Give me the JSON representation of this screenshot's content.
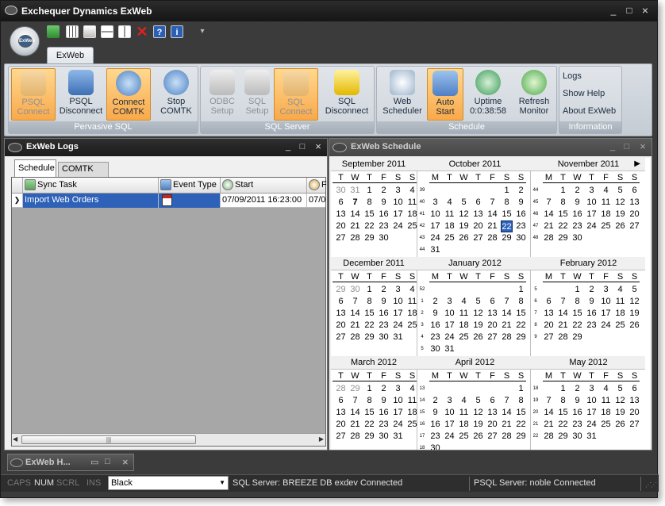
{
  "window": {
    "title": "Exchequer Dynamics ExWeb",
    "controls": [
      "_",
      "□",
      "×"
    ]
  },
  "app_orb": {
    "label": "ExWeb"
  },
  "quick_access": {
    "icons": [
      "export-icon",
      "table-icon",
      "windows-cascade-icon",
      "tile-horizontal-icon",
      "tile-vertical-icon",
      "close-red-x-icon",
      "help-icon",
      "info-icon"
    ],
    "more": "▾"
  },
  "ribbon": {
    "tab": "ExWeb",
    "groups": [
      {
        "label": "Pervasive SQL",
        "buttons": [
          {
            "line1": "PSQL",
            "line2": "Connect",
            "state": "highlighted-disabled"
          },
          {
            "line1": "PSQL",
            "line2": "Disconnect",
            "state": "normal"
          },
          {
            "line1": "Connect",
            "line2": "COMTK",
            "state": "highlighted"
          },
          {
            "line1": "Stop",
            "line2": "COMTK",
            "state": "normal"
          }
        ]
      },
      {
        "label": "SQL Server",
        "buttons": [
          {
            "line1": "ODBC",
            "line2": "Setup",
            "state": "disabled"
          },
          {
            "line1": "SQL",
            "line2": "Setup",
            "state": "disabled"
          },
          {
            "line1": "SQL",
            "line2": "Connect",
            "state": "highlighted-disabled"
          },
          {
            "line1": "SQL",
            "line2": "Disconnect",
            "state": "normal"
          }
        ]
      },
      {
        "label": "Schedule",
        "buttons": [
          {
            "line1": "Web",
            "line2": "Scheduler",
            "state": "normal"
          },
          {
            "line1": "Auto",
            "line2": "Start",
            "state": "highlighted"
          },
          {
            "line1": "Uptime",
            "line2": "0:0:38:58",
            "state": "normal"
          },
          {
            "line1": "Refresh",
            "line2": "Monitor",
            "state": "normal"
          }
        ]
      },
      {
        "label": "Information",
        "links": [
          "Logs",
          "Show Help",
          "About ExWeb"
        ]
      }
    ]
  },
  "logs_panel": {
    "title": "ExWeb Logs",
    "tabs": [
      "Schedule",
      "COMTK Log"
    ],
    "columns": [
      "Sync Task",
      "Event Type",
      "Start",
      "F"
    ],
    "rows": [
      {
        "sync_task": "Import Web Orders",
        "event_type": "",
        "start": "07/09/2011 16:23:00",
        "finish": "07/0"
      }
    ]
  },
  "schedule_panel": {
    "title": "ExWeb Schedule",
    "dow": [
      "T",
      "W",
      "T",
      "F",
      "S",
      "S"
    ],
    "dow_full": [
      "M",
      "T",
      "W",
      "T",
      "F",
      "S",
      "S"
    ],
    "months": [
      {
        "name": "September 2011",
        "leading_grey": [
          "30",
          "31"
        ]
      },
      {
        "name": "October 2011"
      },
      {
        "name": "November 2011"
      },
      {
        "name": "December 2011"
      },
      {
        "name": "January 2012"
      },
      {
        "name": "February 2012"
      },
      {
        "name": "March 2012"
      },
      {
        "name": "April 2012"
      },
      {
        "name": "May 2012"
      }
    ],
    "today": "7",
    "selected": "22",
    "next_arrow": "▶"
  },
  "dock": {
    "panel_title": "ExWeb H..."
  },
  "statusbar": {
    "caps": "CAPS",
    "num": "NUM",
    "scrl": "SCRL",
    "ins": "INS",
    "theme": "Black",
    "sql_status": "SQL Server: BREEZE DB exdev Connected",
    "psql_status": "PSQL Server: noble Connected"
  }
}
